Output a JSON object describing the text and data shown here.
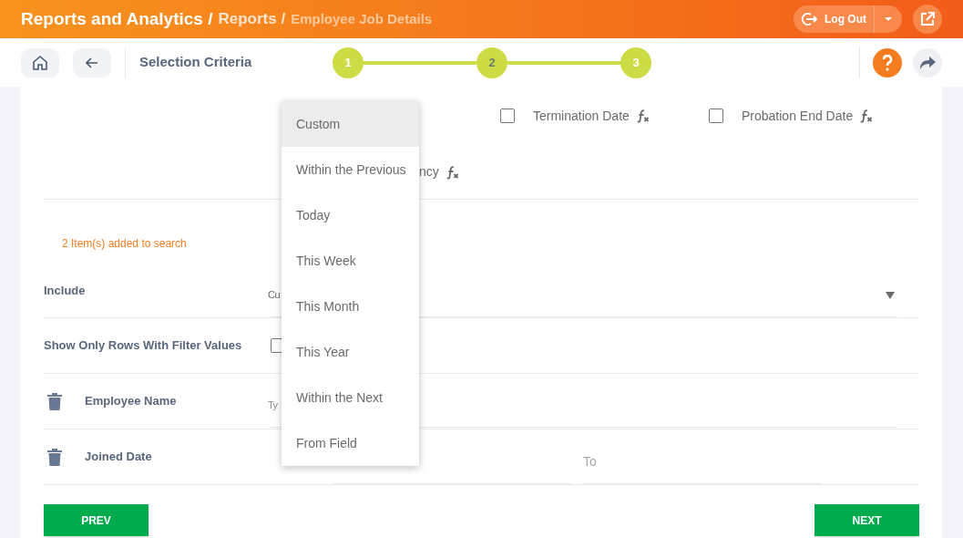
{
  "header": {
    "breadcrumb": [
      "Reports and Analytics /",
      "Reports /",
      "Employee Job Details"
    ],
    "logout": "Log Out"
  },
  "toolbar": {
    "title": "Selection Criteria",
    "steps": [
      "1",
      "2",
      "3"
    ]
  },
  "fields": [
    {
      "label": "Termination Date",
      "checked": false
    },
    {
      "label": "Probation End Date",
      "checked": false
    }
  ],
  "partial_field": "ncy",
  "message": "2 Item(s) added to search",
  "include": {
    "label": "Include",
    "value": "Cu"
  },
  "show_only": {
    "label": "Show Only Rows With Filter Values",
    "checked": false
  },
  "filters": [
    {
      "kind": "text",
      "label": "Employee Name",
      "placeholder": "Ty"
    },
    {
      "kind": "range",
      "label": "Joined Date",
      "to_placeholder": "To"
    }
  ],
  "buttons": {
    "prev": "PREV",
    "next": "NEXT"
  },
  "dropdown": [
    {
      "label": "Custom",
      "selected": true
    },
    {
      "label": "Within the Previous",
      "selected": false
    },
    {
      "label": "Today",
      "selected": false
    },
    {
      "label": "This Week",
      "selected": false
    },
    {
      "label": "This Month",
      "selected": false
    },
    {
      "label": "This Year",
      "selected": false
    },
    {
      "label": "Within the Next",
      "selected": false
    },
    {
      "label": "From Field",
      "selected": false
    }
  ]
}
